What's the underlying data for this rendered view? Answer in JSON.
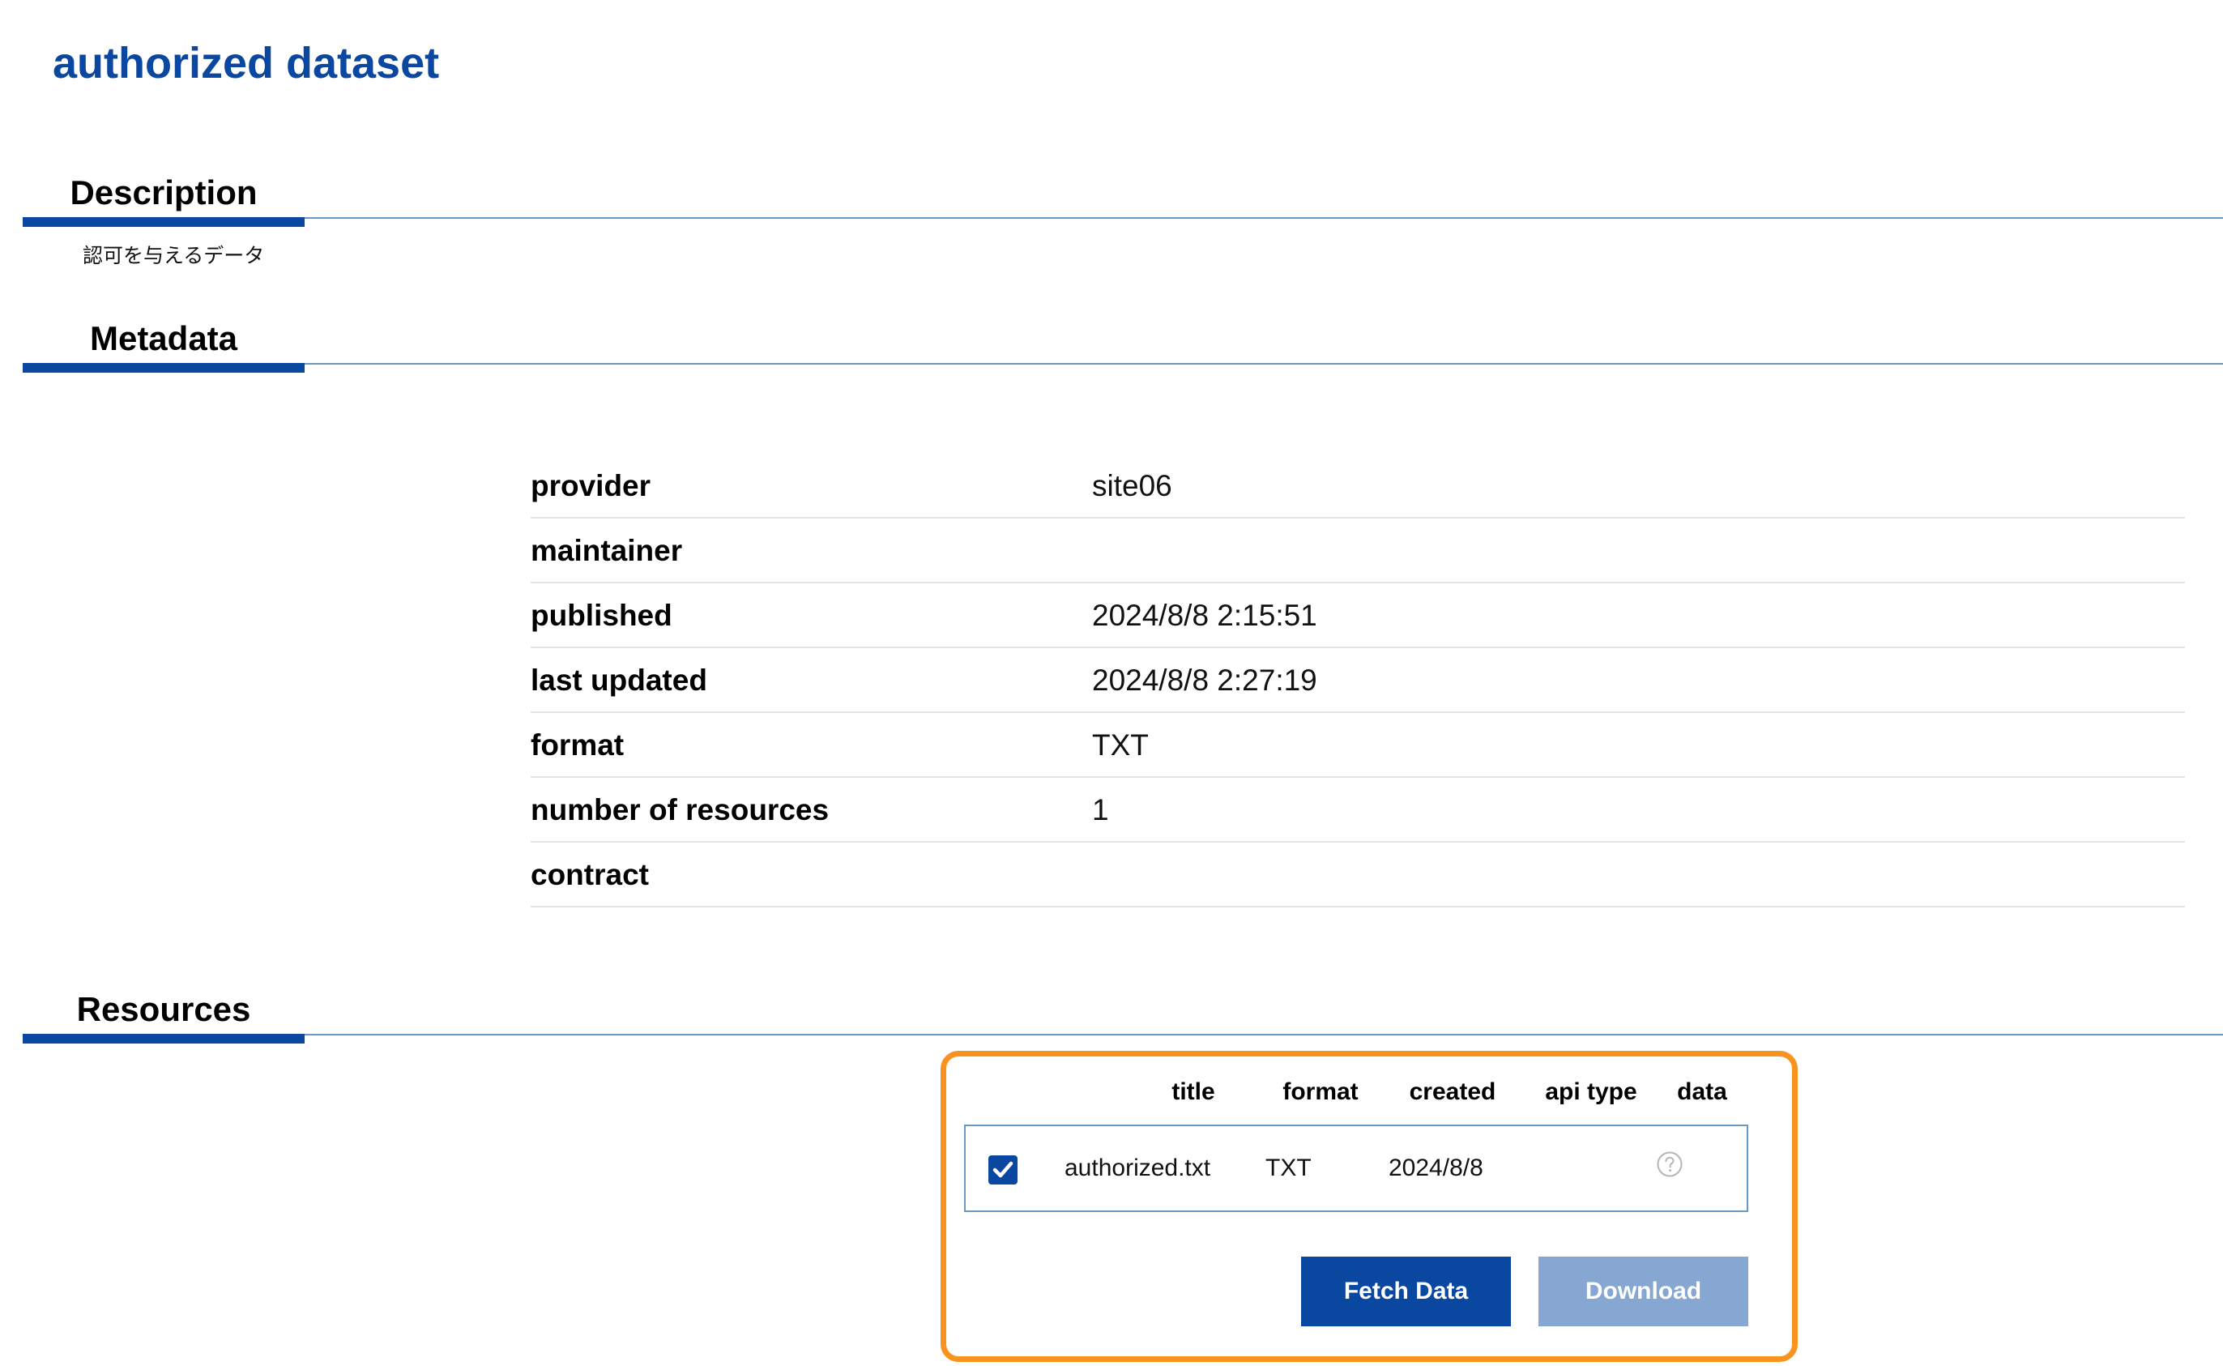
{
  "page": {
    "title": "authorized dataset"
  },
  "sections": {
    "description": "Description",
    "metadata": "Metadata",
    "resources": "Resources"
  },
  "description": {
    "text": "認可を与えるデータ"
  },
  "metadata": {
    "rows": [
      {
        "key": "provider",
        "value": "site06"
      },
      {
        "key": "maintainer",
        "value": ""
      },
      {
        "key": "published",
        "value": "2024/8/8 2:15:51"
      },
      {
        "key": "last updated",
        "value": "2024/8/8 2:27:19"
      },
      {
        "key": "format",
        "value": "TXT"
      },
      {
        "key": "number of resources",
        "value": "1"
      },
      {
        "key": "contract",
        "value": ""
      }
    ]
  },
  "resources": {
    "columns": [
      "title",
      "format",
      "created",
      "api type",
      "data"
    ],
    "rows": [
      {
        "checked": true,
        "title": "authorized.txt",
        "format": "TXT",
        "created": "2024/8/8",
        "api_type": "",
        "data_icon": "help-circle-icon"
      }
    ],
    "buttons": {
      "fetch": "Fetch Data",
      "download": "Download"
    }
  },
  "colors": {
    "brand_blue": "#0a47a1",
    "section_line": "#6b98c2",
    "highlight_orange": "#f7931e",
    "disabled_button": "#86a7d1"
  }
}
